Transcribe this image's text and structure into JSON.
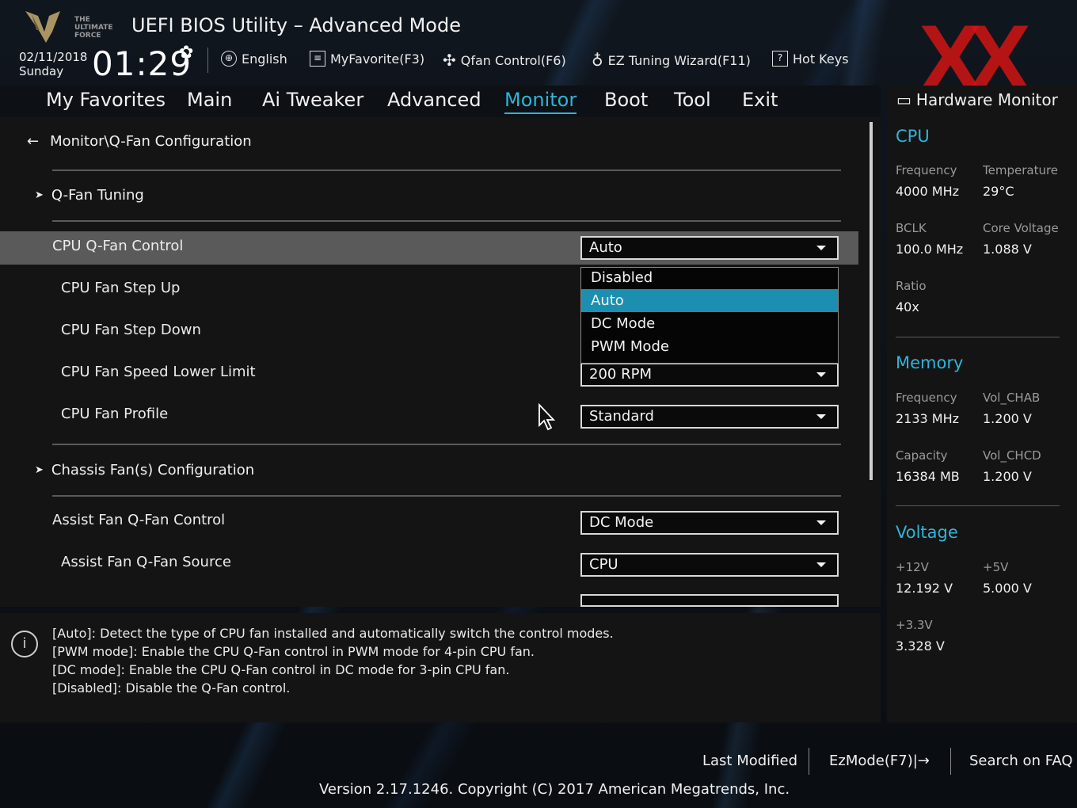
{
  "header": {
    "logo_text": "THE ULTIMATE FORCE",
    "title": "UEFI BIOS Utility – Advanced Mode",
    "date": "02/11/2018",
    "day": "Sunday",
    "time": "01:29",
    "tools": {
      "language": "English",
      "favorite": "MyFavorite(F3)",
      "qfan": "Qfan Control(F6)",
      "ez_tuning": "EZ Tuning Wizard(F11)",
      "hot_keys": "Hot Keys"
    }
  },
  "menu": {
    "items": [
      "My Favorites",
      "Main",
      "Ai Tweaker",
      "Advanced",
      "Monitor",
      "Boot",
      "Tool",
      "Exit"
    ],
    "active": "Monitor"
  },
  "main": {
    "breadcrumb": "Monitor\\Q-Fan Configuration",
    "section_qfan_tuning": "Q-Fan Tuning",
    "cpu_qfan_control": {
      "label": "CPU Q-Fan Control",
      "value": "Auto"
    },
    "cpu_fan_step_up": {
      "label": "CPU Fan Step Up"
    },
    "cpu_fan_step_down": {
      "label": "CPU Fan Step Down"
    },
    "cpu_fan_speed_lower_limit": {
      "label": "CPU Fan Speed Lower Limit",
      "value": "200 RPM"
    },
    "cpu_fan_profile": {
      "label": "CPU Fan Profile",
      "value": "Standard"
    },
    "section_chassis": "Chassis Fan(s) Configuration",
    "assist_fan_control": {
      "label": "Assist Fan Q-Fan Control",
      "value": "DC Mode"
    },
    "assist_fan_source": {
      "label": "Assist Fan Q-Fan Source",
      "value": "CPU"
    },
    "dropdown_options": [
      "Disabled",
      "Auto",
      "DC Mode",
      "PWM Mode"
    ],
    "dropdown_selected": "Auto"
  },
  "help": {
    "lines": [
      "[Auto]: Detect the type of CPU fan installed and automatically switch the control modes.",
      "[PWM mode]: Enable the CPU Q-Fan control in PWM mode for 4-pin CPU fan.",
      "[DC mode]: Enable the CPU Q-Fan control in DC mode for 3-pin CPU fan.",
      "[Disabled]: Disable the Q-Fan control."
    ]
  },
  "hw_monitor": {
    "title": "Hardware Monitor",
    "cpu": {
      "heading": "CPU",
      "frequency_label": "Frequency",
      "frequency": "4000 MHz",
      "temperature_label": "Temperature",
      "temperature": "29°C",
      "bclk_label": "BCLK",
      "bclk": "100.0 MHz",
      "core_voltage_label": "Core Voltage",
      "core_voltage": "1.088 V",
      "ratio_label": "Ratio",
      "ratio": "40x"
    },
    "memory": {
      "heading": "Memory",
      "frequency_label": "Frequency",
      "frequency": "2133 MHz",
      "vol_chab_label": "Vol_CHAB",
      "vol_chab": "1.200 V",
      "capacity_label": "Capacity",
      "capacity": "16384 MB",
      "vol_chcd_label": "Vol_CHCD",
      "vol_chcd": "1.200 V"
    },
    "voltage": {
      "heading": "Voltage",
      "v12_label": "+12V",
      "v12": "12.192 V",
      "v5_label": "+5V",
      "v5": "5.000 V",
      "v33_label": "+3.3V",
      "v33": "3.328 V"
    }
  },
  "footer": {
    "last_modified": "Last Modified",
    "ezmode": "EzMode(F7)|→",
    "search_faq": "Search on FAQ",
    "version": "Version 2.17.1246. Copyright (C) 2017 American Megatrends, Inc."
  },
  "colors": {
    "accent": "#2fb4d8",
    "selected_option": "#1c8fb0",
    "brand_mark": "#d21414"
  }
}
